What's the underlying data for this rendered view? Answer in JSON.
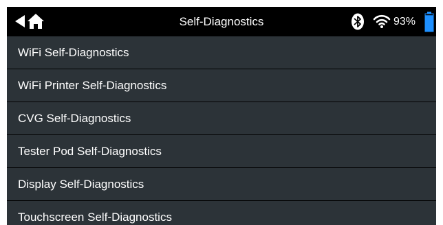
{
  "header": {
    "title": "Self-Diagnostics",
    "back_icon": "back-arrow-icon",
    "home_icon": "home-icon",
    "bluetooth_icon": "bluetooth-icon",
    "wifi_icon": "wifi-icon",
    "battery_icon": "battery-icon",
    "battery_percent": "93%",
    "battery_level": 0.93
  },
  "colors": {
    "header_bg": "#000000",
    "screen_bg": "#2c3338",
    "divider": "#000000",
    "battery_fill": "#1e90ff",
    "text": "#ffffff"
  },
  "menu": {
    "items": [
      {
        "label": "WiFi Self-Diagnostics"
      },
      {
        "label": "WiFi Printer Self-Diagnostics"
      },
      {
        "label": "CVG Self-Diagnostics"
      },
      {
        "label": "Tester Pod Self-Diagnostics"
      },
      {
        "label": "Display Self-Diagnostics"
      },
      {
        "label": "Touchscreen Self-Diagnostics"
      }
    ]
  }
}
